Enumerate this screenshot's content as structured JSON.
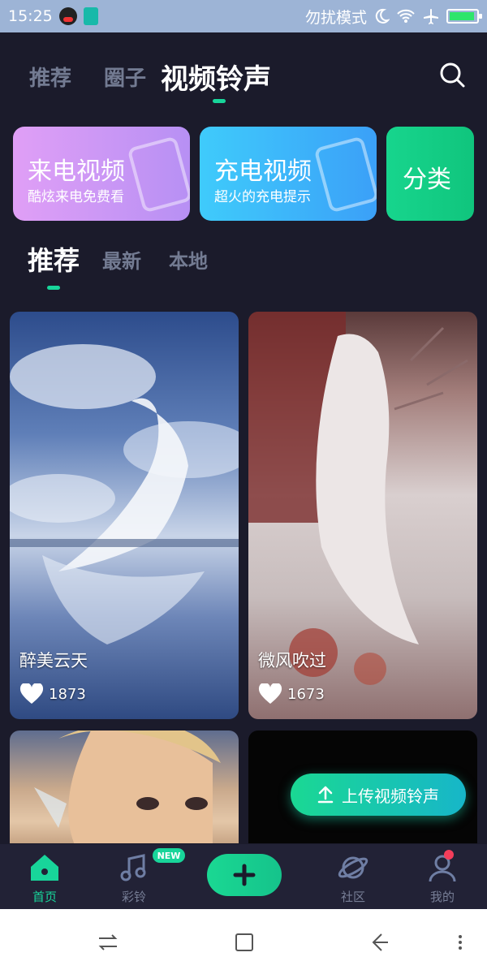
{
  "status_bar": {
    "time": "15:25",
    "dnd_label": "勿扰模式"
  },
  "top_tabs": [
    {
      "label": "推荐"
    },
    {
      "label": "圈子"
    },
    {
      "label": "视频铃声"
    }
  ],
  "banners": [
    {
      "title": "来电视频",
      "subtitle": "酷炫来电免费看"
    },
    {
      "title": "充电视频",
      "subtitle": "超火的充电提示"
    },
    {
      "title": "分类"
    }
  ],
  "sub_tabs": [
    {
      "label": "推荐"
    },
    {
      "label": "最新"
    },
    {
      "label": "本地"
    }
  ],
  "videos": [
    {
      "name": "醉美云天",
      "likes": "1873"
    },
    {
      "name": "微风吹过",
      "likes": "1673"
    }
  ],
  "upload_label": "上传视频铃声",
  "bottom_nav": {
    "items": [
      {
        "label": "首页"
      },
      {
        "label": "彩铃"
      },
      {
        "label": "社区"
      },
      {
        "label": "我的"
      }
    ],
    "new_badge": "NEW"
  },
  "colors": {
    "background": "#1b1b2b",
    "accent": "#18d59a",
    "inactive_text": "#737b92"
  }
}
